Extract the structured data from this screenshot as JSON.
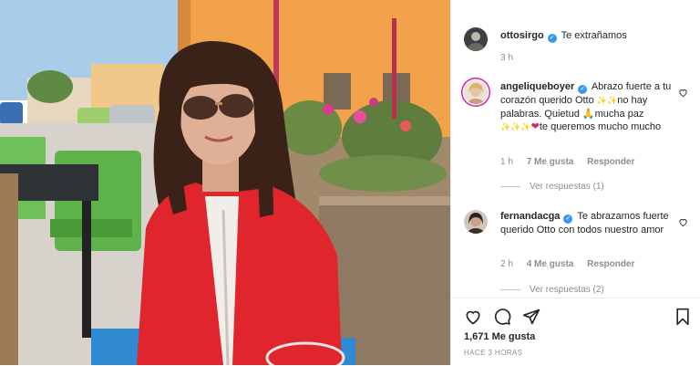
{
  "post": {
    "author": "ottosirgo",
    "caption": "Te extrañamos",
    "time": "3 h"
  },
  "comments": [
    {
      "user": "angeliqueboyer",
      "text_parts": [
        "Abrazo fuerte a tu corazón querido Otto ",
        "✨✨",
        "no hay palabras. Quietud ",
        "🙏",
        "mucha paz ",
        "✨✨✨",
        "❤",
        "te queremos mucho mucho"
      ],
      "time": "1 h",
      "likes": "7 Me gusta",
      "reply": "Responder",
      "view_replies": "Ver respuestas (1)"
    },
    {
      "user": "fernandacga",
      "text": "Te abrazamos fuerte querido Otto con todos nuestro amor",
      "time": "2 h",
      "likes": "4 Me gusta",
      "reply": "Responder",
      "view_replies": "Ver respuestas (2)"
    }
  ],
  "footer": {
    "likes": "1,671 Me gusta",
    "time_ago": "HACE 3 HORAS"
  },
  "icons": {
    "like": "heart-icon",
    "comment": "comment-icon",
    "share": "share-icon",
    "save": "bookmark-icon"
  },
  "colors": {
    "verified": "#3897f0",
    "muted": "#8e8e8e",
    "jacket": "#e0262c"
  }
}
